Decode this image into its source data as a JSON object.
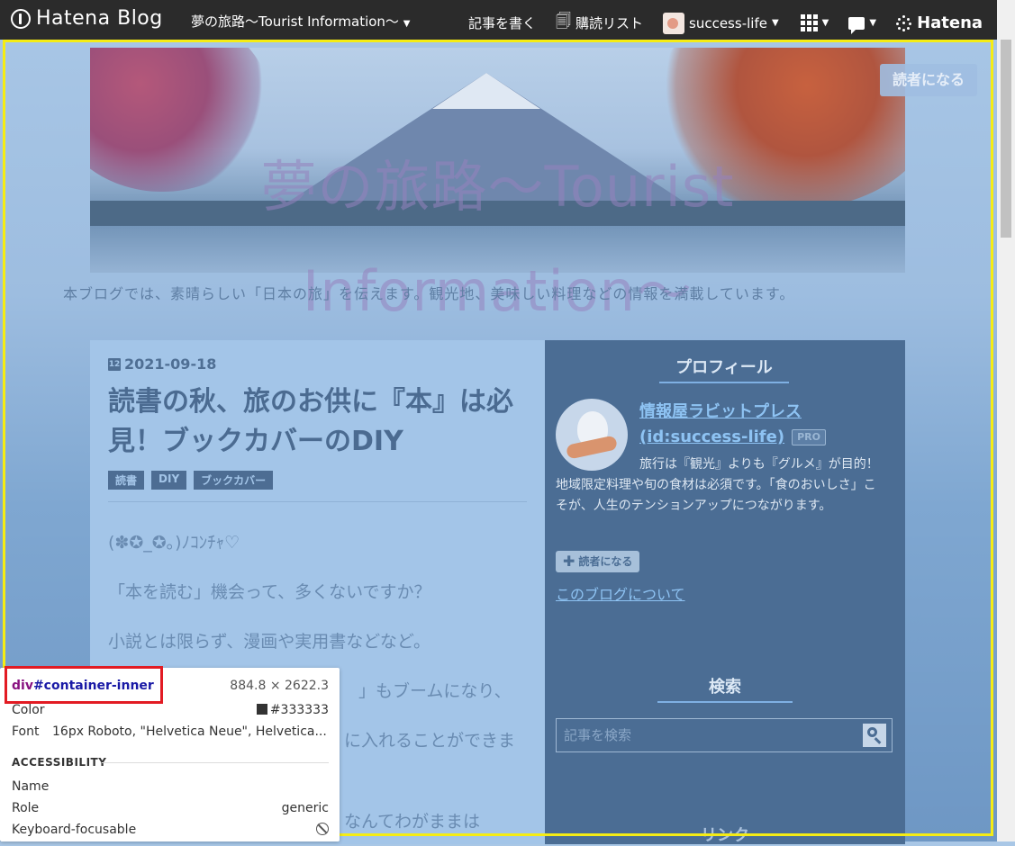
{
  "topbar": {
    "logo_text": "Hatena Blog",
    "blog_switcher": "夢の旅路〜Tourist Information〜",
    "write": "記事を書く",
    "reading_list": "購読リスト",
    "user": "success-life",
    "hatena": "Hatena"
  },
  "header": {
    "title": "夢の旅路〜Tourist Information〜",
    "subscribe": "読者になる",
    "description": "本ブログでは、素晴らしい「日本の旅」を伝えます。観光地、美味しい料理などの情報を満載しています。"
  },
  "entry": {
    "date_icon": "12",
    "date": "2021-09-18",
    "title": "読書の秋、旅のお供に『本』は必見！ブックカバーのDIY",
    "tags": [
      "読書",
      "DIY",
      "ブックカバー"
    ],
    "paragraphs": [
      "(✽✪_✪｡)ﾉｺﾝﾁｬ♡",
      "「本を読む」機会って、多くないですか？",
      "小説とは限らず、漫画や実用書などなど。",
      "」もブームになり、",
      "に入れることができま",
      "なんてわがままは"
    ]
  },
  "sidebar": {
    "profile_heading": "プロフィール",
    "profile_name": "情報屋ラビットプレス",
    "profile_id": "(id:success-life)",
    "pro": "PRO",
    "profile_desc": "旅行は『観光』よりも『グルメ』が目的！地域限定料理や旬の食材は必須です。「食のおいしさ」こそが、人生のテンションアップにつながります。",
    "subscribe": "読者になる",
    "about": "このブログについて",
    "search_heading": "検索",
    "search_placeholder": "記事を検索",
    "links_heading": "リンク"
  },
  "inspector": {
    "tag": "div",
    "id": "#container-inner",
    "dims": "884.8 × 2622.3",
    "color_label": "Color",
    "color_value": "#333333",
    "font_label": "Font",
    "font_value": "16px Roboto, \"Helvetica Neue\", Helvetica...",
    "accessibility": "ACCESSIBILITY",
    "name_label": "Name",
    "role_label": "Role",
    "role_value": "generic",
    "kb_label": "Keyboard-focusable"
  },
  "colors": {
    "highlight": "#f5ec14",
    "selector_box": "#e21b23",
    "sidebar_bg": "#4b6d94",
    "main_bg": "#a3c5e8"
  }
}
